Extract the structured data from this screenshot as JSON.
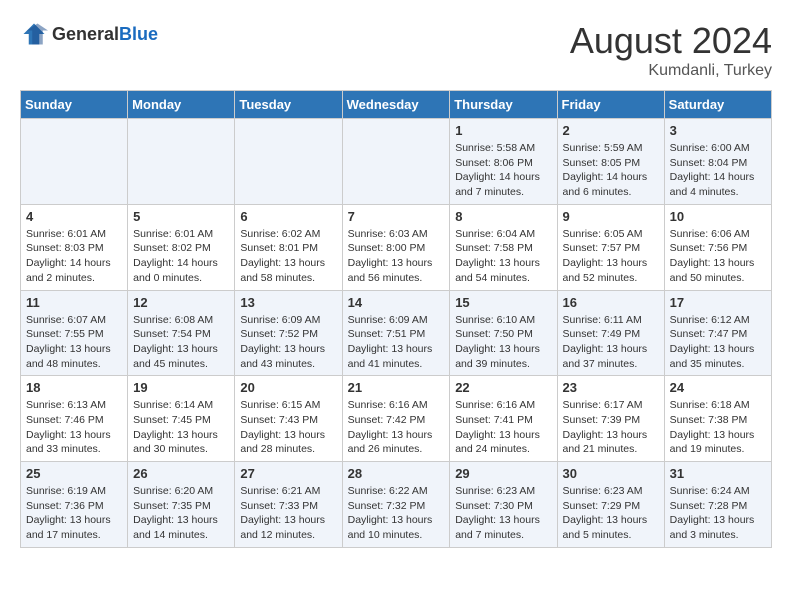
{
  "header": {
    "logo_general": "General",
    "logo_blue": "Blue",
    "title": "August 2024",
    "subtitle": "Kumdanli, Turkey"
  },
  "weekdays": [
    "Sunday",
    "Monday",
    "Tuesday",
    "Wednesday",
    "Thursday",
    "Friday",
    "Saturday"
  ],
  "weeks": [
    [
      {
        "day": "",
        "content": ""
      },
      {
        "day": "",
        "content": ""
      },
      {
        "day": "",
        "content": ""
      },
      {
        "day": "",
        "content": ""
      },
      {
        "day": "1",
        "content": "Sunrise: 5:58 AM\nSunset: 8:06 PM\nDaylight: 14 hours and 7 minutes."
      },
      {
        "day": "2",
        "content": "Sunrise: 5:59 AM\nSunset: 8:05 PM\nDaylight: 14 hours and 6 minutes."
      },
      {
        "day": "3",
        "content": "Sunrise: 6:00 AM\nSunset: 8:04 PM\nDaylight: 14 hours and 4 minutes."
      }
    ],
    [
      {
        "day": "4",
        "content": "Sunrise: 6:01 AM\nSunset: 8:03 PM\nDaylight: 14 hours and 2 minutes."
      },
      {
        "day": "5",
        "content": "Sunrise: 6:01 AM\nSunset: 8:02 PM\nDaylight: 14 hours and 0 minutes."
      },
      {
        "day": "6",
        "content": "Sunrise: 6:02 AM\nSunset: 8:01 PM\nDaylight: 13 hours and 58 minutes."
      },
      {
        "day": "7",
        "content": "Sunrise: 6:03 AM\nSunset: 8:00 PM\nDaylight: 13 hours and 56 minutes."
      },
      {
        "day": "8",
        "content": "Sunrise: 6:04 AM\nSunset: 7:58 PM\nDaylight: 13 hours and 54 minutes."
      },
      {
        "day": "9",
        "content": "Sunrise: 6:05 AM\nSunset: 7:57 PM\nDaylight: 13 hours and 52 minutes."
      },
      {
        "day": "10",
        "content": "Sunrise: 6:06 AM\nSunset: 7:56 PM\nDaylight: 13 hours and 50 minutes."
      }
    ],
    [
      {
        "day": "11",
        "content": "Sunrise: 6:07 AM\nSunset: 7:55 PM\nDaylight: 13 hours and 48 minutes."
      },
      {
        "day": "12",
        "content": "Sunrise: 6:08 AM\nSunset: 7:54 PM\nDaylight: 13 hours and 45 minutes."
      },
      {
        "day": "13",
        "content": "Sunrise: 6:09 AM\nSunset: 7:52 PM\nDaylight: 13 hours and 43 minutes."
      },
      {
        "day": "14",
        "content": "Sunrise: 6:09 AM\nSunset: 7:51 PM\nDaylight: 13 hours and 41 minutes."
      },
      {
        "day": "15",
        "content": "Sunrise: 6:10 AM\nSunset: 7:50 PM\nDaylight: 13 hours and 39 minutes."
      },
      {
        "day": "16",
        "content": "Sunrise: 6:11 AM\nSunset: 7:49 PM\nDaylight: 13 hours and 37 minutes."
      },
      {
        "day": "17",
        "content": "Sunrise: 6:12 AM\nSunset: 7:47 PM\nDaylight: 13 hours and 35 minutes."
      }
    ],
    [
      {
        "day": "18",
        "content": "Sunrise: 6:13 AM\nSunset: 7:46 PM\nDaylight: 13 hours and 33 minutes."
      },
      {
        "day": "19",
        "content": "Sunrise: 6:14 AM\nSunset: 7:45 PM\nDaylight: 13 hours and 30 minutes."
      },
      {
        "day": "20",
        "content": "Sunrise: 6:15 AM\nSunset: 7:43 PM\nDaylight: 13 hours and 28 minutes."
      },
      {
        "day": "21",
        "content": "Sunrise: 6:16 AM\nSunset: 7:42 PM\nDaylight: 13 hours and 26 minutes."
      },
      {
        "day": "22",
        "content": "Sunrise: 6:16 AM\nSunset: 7:41 PM\nDaylight: 13 hours and 24 minutes."
      },
      {
        "day": "23",
        "content": "Sunrise: 6:17 AM\nSunset: 7:39 PM\nDaylight: 13 hours and 21 minutes."
      },
      {
        "day": "24",
        "content": "Sunrise: 6:18 AM\nSunset: 7:38 PM\nDaylight: 13 hours and 19 minutes."
      }
    ],
    [
      {
        "day": "25",
        "content": "Sunrise: 6:19 AM\nSunset: 7:36 PM\nDaylight: 13 hours and 17 minutes."
      },
      {
        "day": "26",
        "content": "Sunrise: 6:20 AM\nSunset: 7:35 PM\nDaylight: 13 hours and 14 minutes."
      },
      {
        "day": "27",
        "content": "Sunrise: 6:21 AM\nSunset: 7:33 PM\nDaylight: 13 hours and 12 minutes."
      },
      {
        "day": "28",
        "content": "Sunrise: 6:22 AM\nSunset: 7:32 PM\nDaylight: 13 hours and 10 minutes."
      },
      {
        "day": "29",
        "content": "Sunrise: 6:23 AM\nSunset: 7:30 PM\nDaylight: 13 hours and 7 minutes."
      },
      {
        "day": "30",
        "content": "Sunrise: 6:23 AM\nSunset: 7:29 PM\nDaylight: 13 hours and 5 minutes."
      },
      {
        "day": "31",
        "content": "Sunrise: 6:24 AM\nSunset: 7:28 PM\nDaylight: 13 hours and 3 minutes."
      }
    ]
  ]
}
